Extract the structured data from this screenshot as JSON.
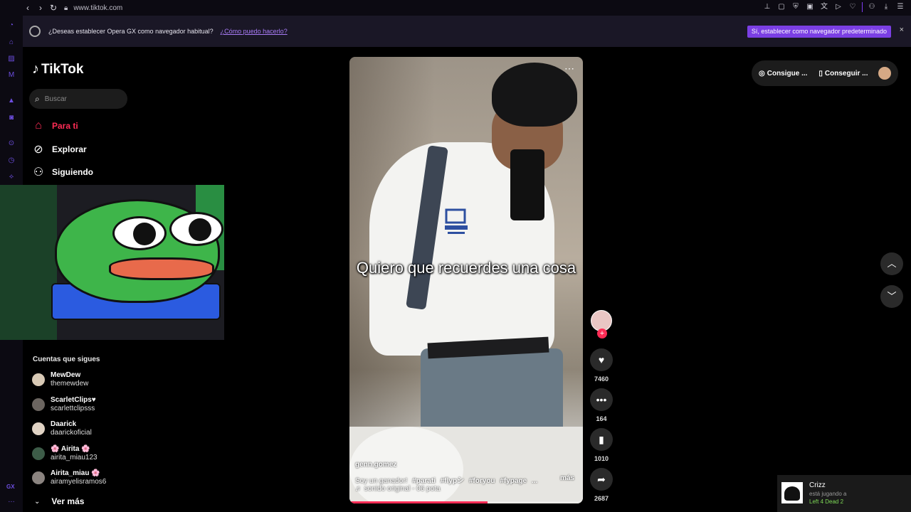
{
  "browser": {
    "url": "www.tiktok.com",
    "nav_icons": [
      "back-icon",
      "forward-icon",
      "reload-icon"
    ],
    "toolbar_icons": [
      "pin-icon",
      "snapshot-icon",
      "shield-icon",
      "screen-icon",
      "translate-icon",
      "play-icon",
      "heart-icon",
      "profile-icon",
      "download-icon",
      "menu-icon"
    ]
  },
  "notice": {
    "text": "¿Deseas establecer Opera GX como navegador habitual?",
    "link": "¿Cómo puedo hacerlo?",
    "button": "Sí, establecer como navegador predeterminado",
    "close": "×",
    "accent_color": "#7b3fe4"
  },
  "rail": {
    "label_gx": "GX",
    "dots": "…"
  },
  "tiktok": {
    "logo": "TikTok",
    "search_placeholder": "Buscar",
    "nav": [
      {
        "label": "Para ti",
        "icon": "home-icon",
        "active": true
      },
      {
        "label": "Explorar",
        "icon": "compass-icon",
        "active": false
      },
      {
        "label": "Siguiendo",
        "icon": "following-icon",
        "active": false
      }
    ],
    "following_title": "Cuentas que sigues",
    "accounts": [
      {
        "name": "MewDew",
        "handle": "themewdew"
      },
      {
        "name": "ScarletClips♥",
        "handle": "scarlettclipsss"
      },
      {
        "name": "Daarick",
        "handle": "daarickoficial"
      },
      {
        "name": "🌸 Airita 🌸",
        "handle": "airita_miau123"
      },
      {
        "name": "Airita_miau 🌸",
        "handle": "airamyelisramos6"
      }
    ],
    "ver_mas": "Ver más",
    "brand_color": "#fe2c55"
  },
  "video": {
    "caption": "Quiero que recuerdes una cosa",
    "author": "genn.gomez",
    "description": "Soy un ganador!",
    "hashtags": [
      "#parati",
      "#flypシ",
      "#foryou",
      "#fypage",
      "..."
    ],
    "more": "más",
    "sound": "♬ sonido original - 06 pota",
    "progress": 0.59,
    "likes": "7460",
    "comments": "164",
    "saves": "1010",
    "shares": "2687"
  },
  "header_pills": [
    {
      "label": "Consigue ...",
      "icon": "coin-icon"
    },
    {
      "label": "Conseguir ...",
      "icon": "phone-icon"
    }
  ],
  "toast": {
    "name": "Crizz",
    "status": "está jugando a",
    "game": "Left 4 Dead 2"
  }
}
